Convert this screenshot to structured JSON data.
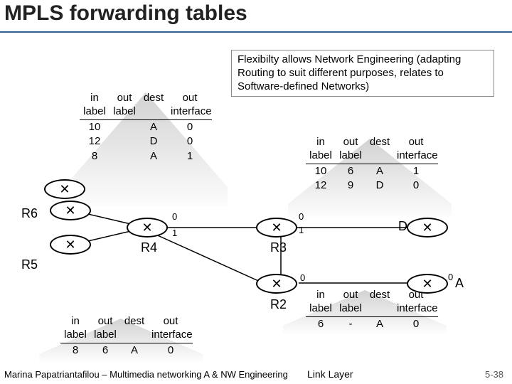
{
  "title": "MPLS forwarding tables",
  "callout": "Flexibilty allows Network Engineering (adapting Routing to suit different purposes, relates to Software-defined Networks)",
  "hdr": {
    "in": "in\nlabel",
    "out": "out\nlabel",
    "dest": "dest",
    "if": "out\ninterface"
  },
  "tables": {
    "r4": {
      "rows": [
        {
          "in": "10",
          "out": "A",
          "dest": "0",
          "if": ""
        },
        {
          "in": "12",
          "out": "D",
          "dest": "0",
          "if": ""
        },
        {
          "in": "8",
          "out": "A",
          "dest": "1",
          "if": ""
        }
      ],
      "rows_v2": [
        {
          "in": "10",
          "out": "",
          "dest": "A",
          "if": "0"
        },
        {
          "in": "12",
          "out": "",
          "dest": "D",
          "if": "0"
        },
        {
          "in": "8",
          "out": "",
          "dest": "A",
          "if": "1"
        }
      ]
    },
    "r3": {
      "rows": [
        {
          "in": "10",
          "out": "6",
          "dest": "A",
          "if": "1"
        },
        {
          "in": "12",
          "out": "9",
          "dest": "D",
          "if": "0"
        }
      ]
    },
    "r2": {
      "rows": [
        {
          "in": "6",
          "out": "-",
          "dest": "A",
          "if": "0"
        }
      ]
    },
    "r5": {
      "rows": [
        {
          "in": "8",
          "out": "6",
          "dest": "A",
          "if": "0"
        }
      ]
    }
  },
  "routers": {
    "r6": "R6",
    "r5": "R5",
    "r4": "R4",
    "r3": "R3",
    "r2": "R2"
  },
  "labels": {
    "D": "D",
    "A": "A"
  },
  "iface": {
    "zero": "0",
    "one": "1"
  },
  "footer": {
    "left": "Marina Papatriantafilou – Multimedia networking A & NW Engineering",
    "linklayer": "Link Layer",
    "right": "5-38"
  }
}
